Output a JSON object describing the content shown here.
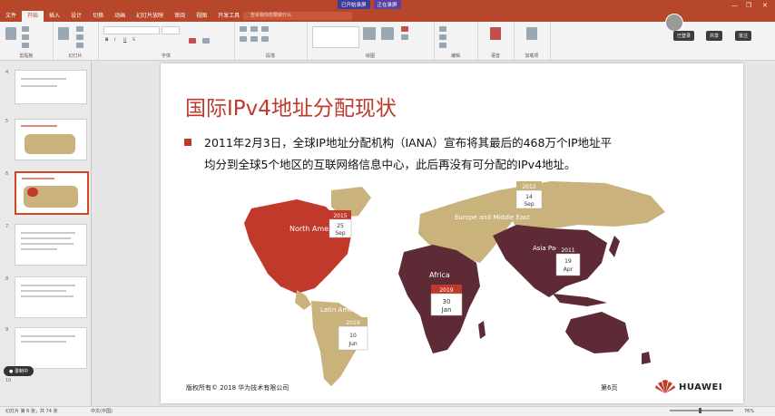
{
  "app": {
    "tabs": [
      "文件",
      "开始",
      "插入",
      "设计",
      "切换",
      "动画",
      "幻灯片放映",
      "审阅",
      "视图",
      "开发工具",
      "帮助"
    ],
    "active_tab": 1,
    "search_placeholder": "告诉我你想要做什么",
    "badges": [
      "已开始录屏",
      "正在录屏"
    ],
    "user_button": "已登录",
    "share_button": "共享",
    "comment_button": "批注",
    "ribbon_groups": [
      "剪贴板",
      "幻灯片",
      "字体",
      "段落",
      "绘图",
      "编辑",
      "语音",
      "加载项"
    ],
    "colors": {
      "accent": "#b7472a",
      "title_red": "#c0392b"
    }
  },
  "sidebar": {
    "thumbs": [
      {
        "num": "4"
      },
      {
        "num": "5"
      },
      {
        "num": "6",
        "selected": true
      },
      {
        "num": "7"
      },
      {
        "num": "8"
      },
      {
        "num": "9"
      },
      {
        "num": "10"
      }
    ]
  },
  "slide": {
    "title": "国际IPv4地址分配现状",
    "body_lines": [
      "2011年2月3日，全球IP地址分配机构（IANA）宣布将其最后的468万个IP地址平",
      "均分到全球5个地区的互联网络信息中心，此后再没有可分配的IPv4地址。"
    ],
    "regions": [
      {
        "name": "North America",
        "year": "2015",
        "day": "25",
        "month": "Sep",
        "color": "#c0392b"
      },
      {
        "name": "Europe and Middle East",
        "year": "2012",
        "day": "14",
        "month": "Sep",
        "color": "#c9b27b"
      },
      {
        "name": "Asia Pacific",
        "year": "2011",
        "day": "19",
        "month": "Apr",
        "color": "#5e2a35"
      },
      {
        "name": "Africa",
        "year": "2019",
        "day": "30",
        "month": "Jan",
        "color": "#5e2a35"
      },
      {
        "name": "Latin America",
        "year": "2014",
        "day": "10",
        "month": "Jun",
        "color": "#c9b27b"
      }
    ],
    "footer_left": "版权所有© 2018 华为技术有限公司",
    "page_label": "第6页",
    "logo_text": "HUAWEI"
  },
  "status": {
    "slide_info": "幻灯片 第 6 张，共 74 张",
    "language": "中文(中国)",
    "zoom": "76%"
  }
}
